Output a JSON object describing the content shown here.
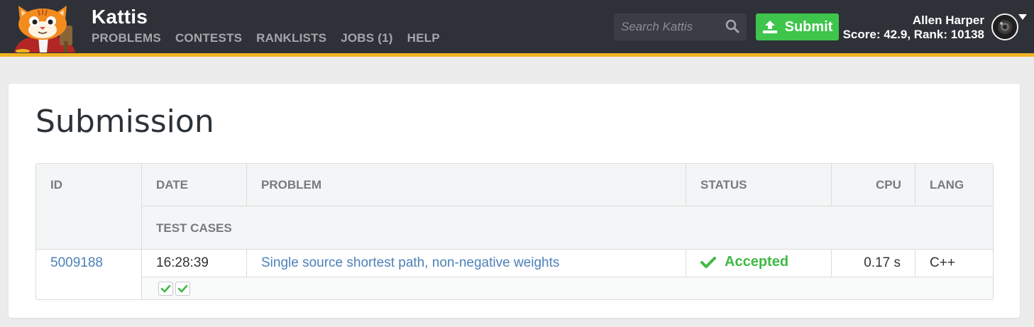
{
  "brand": "Kattis",
  "nav": [
    "PROBLEMS",
    "CONTESTS",
    "RANKLISTS",
    "JOBS (1)",
    "HELP"
  ],
  "search": {
    "placeholder": "Search Kattis"
  },
  "submit_label": "Submit",
  "user": {
    "name": "Allen Harper",
    "score_rank": "Score: 42.9, Rank: 10138"
  },
  "page_title": "Submission",
  "table": {
    "headers": {
      "id": "ID",
      "date": "DATE",
      "problem": "PROBLEM",
      "status": "STATUS",
      "cpu": "CPU",
      "lang": "LANG",
      "test_cases": "TEST CASES"
    },
    "row": {
      "id": "5009188",
      "date": "16:28:39",
      "problem": "Single source shortest path, non-negative weights",
      "status": "Accepted",
      "cpu": "0.17 s",
      "lang": "C++",
      "test_cases_passed": 2
    }
  },
  "colors": {
    "navbar": "#2e3138",
    "accent_bar": "#f0b323",
    "submit_green": "#3fc54b",
    "accepted_green": "#3fb944",
    "link_blue": "#4d81b8"
  },
  "icons": {
    "logo": "kattis-cat-logo",
    "search": "search-icon",
    "submit": "upload-icon",
    "status": "check-icon",
    "avatar": "user-avatar",
    "menu": "caret-down-icon"
  }
}
